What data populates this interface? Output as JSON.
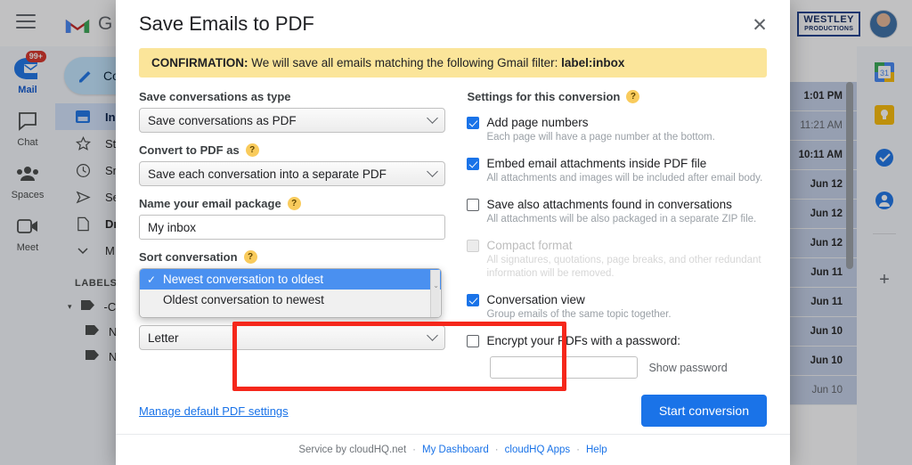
{
  "gmail": {
    "logo_text": "G",
    "hamburger": "menu-icon",
    "rail": [
      {
        "label": "Mail",
        "icon": "mail-icon",
        "badge": "99+",
        "active": true
      },
      {
        "label": "Chat",
        "icon": "chat-icon",
        "badge": "",
        "active": false
      },
      {
        "label": "Spaces",
        "icon": "spaces-icon",
        "badge": "",
        "active": false
      },
      {
        "label": "Meet",
        "icon": "meet-icon",
        "badge": "",
        "active": false
      }
    ],
    "compose_label": "Co",
    "folders": [
      {
        "label": "Inb",
        "icon": "inbox-icon",
        "active": true
      },
      {
        "label": "St",
        "icon": "star-icon",
        "active": false
      },
      {
        "label": "Sn",
        "icon": "clock-icon",
        "active": false
      },
      {
        "label": "Se",
        "icon": "send-icon",
        "active": false
      },
      {
        "label": "Dr",
        "icon": "draft-icon",
        "active": false
      },
      {
        "label": "M",
        "icon": "chevron-down-icon",
        "active": false
      }
    ],
    "labels_header": "LABELS",
    "labels": [
      {
        "label": "-C",
        "indent": false
      },
      {
        "label": "N",
        "indent": true
      },
      {
        "label": "N",
        "indent": true
      }
    ],
    "account_logo_line1": "WESTLEY",
    "account_logo_line2": "PRODUCTIONS",
    "nav_prev": "‹",
    "nav_next": "›",
    "message_times": [
      {
        "time": "1:01 PM",
        "read": false
      },
      {
        "time": "11:21 AM",
        "read": true
      },
      {
        "time": "10:11 AM",
        "read": false
      },
      {
        "time": "Jun 12",
        "read": false
      },
      {
        "time": "Jun 12",
        "read": false
      },
      {
        "time": "Jun 12",
        "read": false
      },
      {
        "time": "Jun 11",
        "read": false
      },
      {
        "time": "Jun 11",
        "read": false
      },
      {
        "time": "Jun 10",
        "read": false
      },
      {
        "time": "Jun 10",
        "read": false
      },
      {
        "time": "Jun 10",
        "read": true
      }
    ],
    "side_panel": [
      {
        "name": "calendar-icon",
        "color": "#4285f4"
      },
      {
        "name": "keep-icon",
        "color": "#fbbc04"
      },
      {
        "name": "tasks-icon",
        "color": "#1a73e8"
      },
      {
        "name": "contacts-icon",
        "color": "#1a73e8"
      }
    ],
    "side_add": "+"
  },
  "modal": {
    "title": "Save Emails to PDF",
    "close_label": "✕",
    "confirmation": {
      "prefix": "CONFIRMATION:",
      "text": " We will save all emails matching the following Gmail filter: ",
      "filter": "label:inbox"
    },
    "left": {
      "save_type_label": "Save conversations as type",
      "save_type_value": "Save conversations as PDF",
      "convert_label": "Convert to PDF as",
      "convert_value": "Save each conversation into a separate PDF",
      "name_label": "Name your email package",
      "name_value": "My inbox",
      "sort_label": "Sort conversation",
      "sort_options": [
        "Newest conversation to oldest",
        "Oldest conversation to newest"
      ],
      "sort_selected": "Newest conversation to oldest",
      "sort_check": "✓",
      "page_size_value": "Letter",
      "help_glyph": "?"
    },
    "right": {
      "heading": "Settings for this conversion",
      "help_glyph": "?",
      "options": [
        {
          "label": "Add page numbers",
          "desc": "Each page will have a page number at the bottom.",
          "checked": true,
          "disabled": false
        },
        {
          "label": "Embed email attachments inside PDF file",
          "desc": "All attachments and images will be included after email body.",
          "checked": true,
          "disabled": false
        },
        {
          "label": "Save also attachments found in conversations",
          "desc": "All attachments will be also packaged in a separate ZIP file.",
          "checked": false,
          "disabled": false
        },
        {
          "label": "Compact format",
          "desc": "All signatures, quotations, page breaks, and other redundant information will be removed.",
          "checked": true,
          "disabled": true
        },
        {
          "label": "Conversation view",
          "desc": "Group emails of the same topic together.",
          "checked": true,
          "disabled": false
        }
      ],
      "encrypt_label": "Encrypt your PDFs with a password:",
      "encrypt_checked": false,
      "password_value": "",
      "show_password_label": "Show password"
    },
    "manage_link": "Manage default PDF settings",
    "start_button": "Start conversion",
    "footer": {
      "service_text": "Service by cloudHQ.net",
      "dashboard": "My Dashboard",
      "apps": "cloudHQ Apps",
      "help": "Help",
      "sep": "·"
    }
  },
  "colors": {
    "accent": "#1a73e8",
    "confirm_bg": "#fbe59a",
    "highlight_red": "#f5271b",
    "dropdown_sel": "#4a90f0"
  }
}
